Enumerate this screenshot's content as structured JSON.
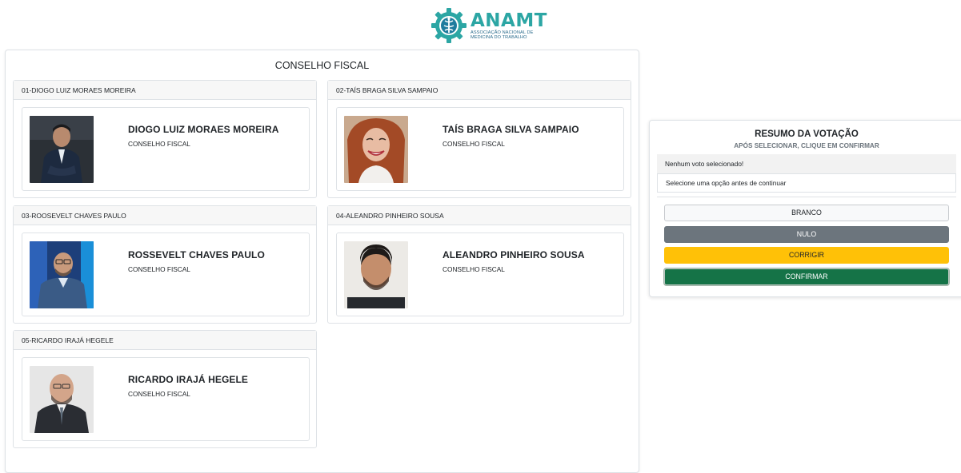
{
  "header": {
    "logo_name": "ANAMT",
    "logo_sub_line1": "ASSOCIAÇÃO NACIONAL DE",
    "logo_sub_line2": "MEDICINA DO TRABALHO"
  },
  "main": {
    "title": "CONSELHO FISCAL",
    "candidates": [
      {
        "header": "01-DIOGO LUIZ MORAES MOREIRA",
        "name": "DIOGO LUIZ MORAES MOREIRA",
        "role": "CONSELHO FISCAL"
      },
      {
        "header": "02-TAÍS BRAGA SILVA SAMPAIO",
        "name": "TAÍS BRAGA SILVA SAMPAIO",
        "role": "CONSELHO FISCAL"
      },
      {
        "header": "03-ROOSEVELT CHAVES PAULO",
        "name": "ROSSEVELT CHAVES PAULO",
        "role": "CONSELHO FISCAL"
      },
      {
        "header": "04-ALEANDRO PINHEIRO SOUSA",
        "name": "ALEANDRO PINHEIRO SOUSA",
        "role": "CONSELHO FISCAL"
      },
      {
        "header": "05-RICARDO IRAJÁ HEGELE",
        "name": "RICARDO IRAJÁ HEGELE",
        "role": "CONSELHO FISCAL"
      }
    ]
  },
  "summary": {
    "title": "RESUMO DA VOTAÇÃO",
    "subtitle": "APÓS SELECIONAR, CLIQUE EM CONFIRMAR",
    "status": "Nenhum voto selecionado!",
    "hint": "Selecione uma opção antes de continuar",
    "buttons": {
      "branco": "BRANCO",
      "nulo": "NULO",
      "corrigir": "CORRIGIR",
      "confirmar": "CONFIRMAR"
    }
  },
  "colors": {
    "brand_teal": "#2ca6a4",
    "btn_secondary": "#6c757d",
    "btn_warning": "#ffc107",
    "btn_success": "#157347"
  }
}
